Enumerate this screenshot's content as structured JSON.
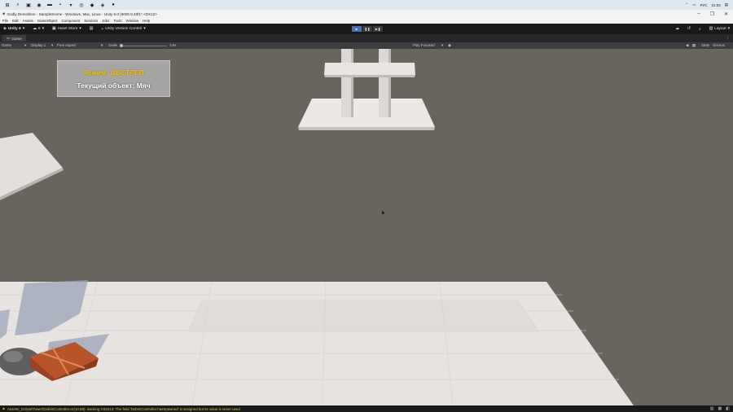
{
  "taskbar": {
    "icons": [
      "windows-icon",
      "search-icon",
      "taskview-icon",
      "edge-icon",
      "explorer-icon",
      "app-icon",
      "app-icon",
      "app-icon",
      "app-icon",
      "unity-icon",
      "app-icon"
    ],
    "lang": "РУС",
    "time": "21:03"
  },
  "window": {
    "title": "Godly Demolition - SampleScene - Windows, Mac, Linux - Unity 6.0 (6000.0.40f1* <DX12>"
  },
  "menu": [
    "File",
    "Edit",
    "Assets",
    "GameObject",
    "Component",
    "Services",
    "Jobs",
    "Tools",
    "Window",
    "Help"
  ],
  "toolbar": {
    "account": "Unity 6",
    "cloud_label": "6",
    "asset_store": "Asset Store",
    "version_control": "Unity Version Control",
    "layout": "Layout"
  },
  "tabs": {
    "game": "Game"
  },
  "gamebar": {
    "display_mode": "Game",
    "display": "Display 1",
    "aspect": "Free Aspect",
    "scale_label": "Scale",
    "scale_value": "1.0x",
    "play_mode": "Play Focused",
    "stats": "Stats",
    "gizmos": "Gizmos"
  },
  "hud": {
    "mode_label": "Режим: ОБСТРЕЛ",
    "object_label": "Текущий объект: Мяч"
  },
  "status": {
    "message": "Assets\\_Scripts\\Tower\\DebrisController.cs(10,58): warning CS0414: The field 'DebrisController.hasSpawned' is assigned but its value is never used"
  },
  "colors": {
    "game_bg": "#6a645f",
    "hud_mode": "#f2c21b",
    "status_warn": "#e6c44a"
  }
}
